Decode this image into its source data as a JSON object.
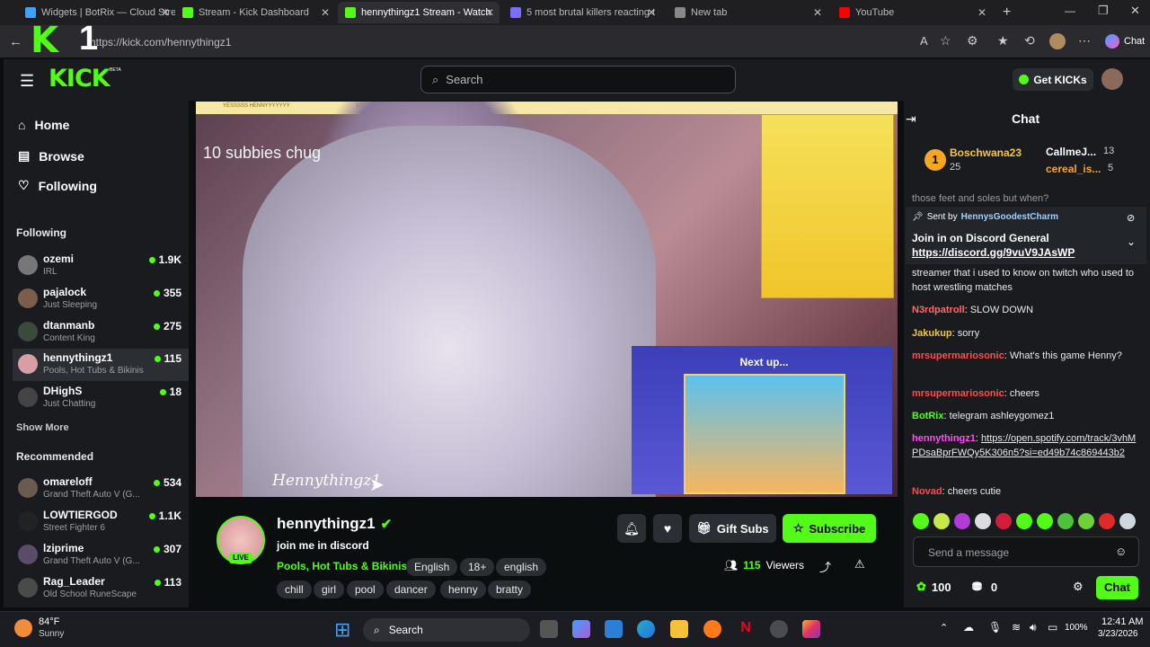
{
  "browser": {
    "tabs": [
      {
        "label": "Widgets | BotRix — Cloud Stre",
        "fav": "#3fa0ff"
      },
      {
        "label": "Stream - Kick Dashboard",
        "fav": "#53fc18"
      },
      {
        "label": "hennythingz1 Stream - Watch",
        "fav": "#53fc18"
      },
      {
        "label": "5 most brutal killers reacting t",
        "fav": "#7c6cff"
      },
      {
        "label": "New tab",
        "fav": "#888888"
      },
      {
        "label": "YouTube",
        "fav": "#ff0000"
      }
    ],
    "url": "https://kick.com/hennythingz1",
    "chat_button": "Chat"
  },
  "overlay": {
    "logo": "K",
    "number": "1"
  },
  "site": {
    "logo": "KICK",
    "logo_badge": "BETA",
    "search_placeholder": "Search",
    "get_kicks": "Get KICKs",
    "nav": {
      "home": "Home",
      "browse": "Browse",
      "following": "Following"
    },
    "following_header": "Following",
    "following": [
      {
        "name": "ozemi",
        "sub": "IRL",
        "viewers": "1.9K"
      },
      {
        "name": "pajalock",
        "sub": "Just Sleeping",
        "viewers": "355"
      },
      {
        "name": "dtanmanb",
        "sub": "Content King",
        "viewers": "275"
      },
      {
        "name": "hennythingz1",
        "sub": "Pools, Hot Tubs & Bikinis",
        "viewers": "115"
      },
      {
        "name": "DHighS",
        "sub": "Just Chatting",
        "viewers": "18"
      }
    ],
    "show_more": "Show More",
    "recommended_header": "Recommended",
    "recommended": [
      {
        "name": "omareloff",
        "sub": "Grand Theft Auto V (G...",
        "viewers": "534"
      },
      {
        "name": "LOWTIERGOD",
        "sub": "Street Fighter 6",
        "viewers": "1.1K"
      },
      {
        "name": "lziprime",
        "sub": "Grand Theft Auto V (G...",
        "viewers": "307"
      },
      {
        "name": "Rag_Leader",
        "sub": "Old School RuneScape",
        "viewers": "113"
      }
    ]
  },
  "video": {
    "overlay_text": "10 subbies chug",
    "signature": "Hennythingz1",
    "next_up": "Next up...",
    "progress_label": "YESSSSS HENNYYYYYYY",
    "progress_value": "100"
  },
  "channel": {
    "name": "hennythingz1",
    "title": "join me in discord",
    "category": "Pools, Hot Tubs & Bikinis",
    "live": "LIVE",
    "tags_row1": [
      "English",
      "18+",
      "english"
    ],
    "tags_row2": [
      "chill",
      "girl",
      "pool",
      "dancer",
      "henny",
      "bratty"
    ],
    "gift_subs": "Gift Subs",
    "subscribe": "Subscribe",
    "viewers": "115",
    "viewers_label": "Viewers"
  },
  "chat": {
    "title": "Chat",
    "top_gifters": [
      {
        "name": "Boschwana23",
        "count": "25"
      },
      {
        "name": "CallmeJ...",
        "count": "13"
      },
      {
        "name": "cereal_is...",
        "count": "5"
      }
    ],
    "cut_text": "those feet and soles but when?",
    "pinned_by": "Sent by",
    "pinned_user": "HennysGoodestCharm",
    "pinned_line": "Join in on Discord General",
    "pinned_link": "https://discord.gg/9vuV9JAsWP",
    "messages": [
      {
        "user": "",
        "color": "#e9e9e9",
        "text": "streamer that i used to know on twitch who used to host wrestling matches"
      },
      {
        "user": "N3rdpatroll",
        "color": "#ff6b6b",
        "text": "SLOW DOWN"
      },
      {
        "user": "Jakukup",
        "color": "#f5c542",
        "text": "sorry"
      },
      {
        "user": "mrsupermariosonic",
        "color": "#ff4d4d",
        "text": "What's this game Henny?"
      },
      {
        "user": "mrsupermariosonic",
        "color": "#ff4d4d",
        "text": "cheers"
      },
      {
        "user": "BotRix",
        "color": "#53fc18",
        "text": "telegram ashleygomez1"
      },
      {
        "user": "hennythingz1",
        "color": "#ff4df0",
        "text": "https://open.spotify.com/track/3vhMPDsaBprFWQy5K306n5?si=ed49b74c869443b2"
      },
      {
        "user": "Novad",
        "color": "#ff4d4d",
        "text": "cheers cutie"
      }
    ],
    "input_placeholder": "Send a message",
    "kicks": "100",
    "points": "0",
    "send": "Chat"
  },
  "taskbar": {
    "temp": "84°F",
    "weather": "Sunny",
    "search": "Search",
    "battery": "100%",
    "time": "12:41 AM",
    "date": "3/23/2026"
  }
}
